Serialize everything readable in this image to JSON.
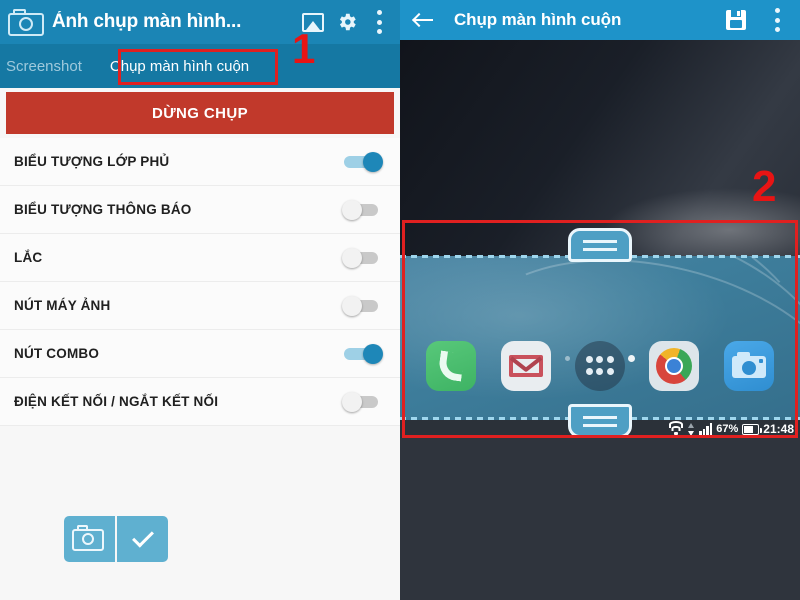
{
  "left": {
    "app_bar": {
      "camera_icon": "camera-icon",
      "title": "Ảnh chụp màn hình...",
      "gallery_icon": "gallery-icon",
      "settings_icon": "gear-icon",
      "overflow_icon": "overflow-menu-icon"
    },
    "tabs": [
      {
        "label": "Screenshot",
        "active": false
      },
      {
        "label": "Chụp màn hình cuộn",
        "active": true
      }
    ],
    "annotation": "1",
    "stop_button": "DỪNG CHỤP",
    "options": [
      {
        "label": "BIỂU TƯỢNG LỚP PHỦ",
        "on": true
      },
      {
        "label": "BIỂU TƯỢNG THÔNG BÁO",
        "on": false
      },
      {
        "label": "LẮC",
        "on": false
      },
      {
        "label": "NÚT MÁY ẢNH",
        "on": false
      },
      {
        "label": "NÚT COMBO",
        "on": true
      },
      {
        "label": "ĐIỆN KẾT NỐI / NGẮT KẾT NỐI",
        "on": false
      }
    ],
    "floating_widget": {
      "camera_icon": "camera-icon",
      "confirm_icon": "check-icon"
    }
  },
  "right": {
    "app_bar": {
      "back_icon": "back-arrow-icon",
      "title": "Chụp màn hình cuộn",
      "save_icon": "save-icon",
      "overflow_icon": "overflow-menu-icon"
    },
    "annotation": "2",
    "dock_apps": [
      {
        "name": "phone-app-icon"
      },
      {
        "name": "gmail-app-icon"
      },
      {
        "name": "app-drawer-icon"
      },
      {
        "name": "chrome-app-icon"
      },
      {
        "name": "camera-app-icon"
      }
    ],
    "page_dots": {
      "count": 4,
      "current_index": 3
    },
    "status_bar": {
      "wifi_icon": "wifi-icon",
      "data_arrows_icon": "data-transfer-icon",
      "signal_icon": "signal-bars-icon",
      "battery_percent": "67%",
      "battery_icon": "battery-icon",
      "clock": "21:48"
    },
    "handles": {
      "top_handle": "scroll-handle-top",
      "bottom_handle": "scroll-handle-bottom"
    }
  },
  "colors": {
    "app_bar_blue": "#1b85b5",
    "tab_bar_blue": "#1578a3",
    "right_bar_blue": "#1e93c9",
    "stop_red": "#c1392b",
    "annotation_red": "#e02020",
    "toggle_on": "#1e87b8",
    "toggle_off": "#c9c9c9"
  }
}
